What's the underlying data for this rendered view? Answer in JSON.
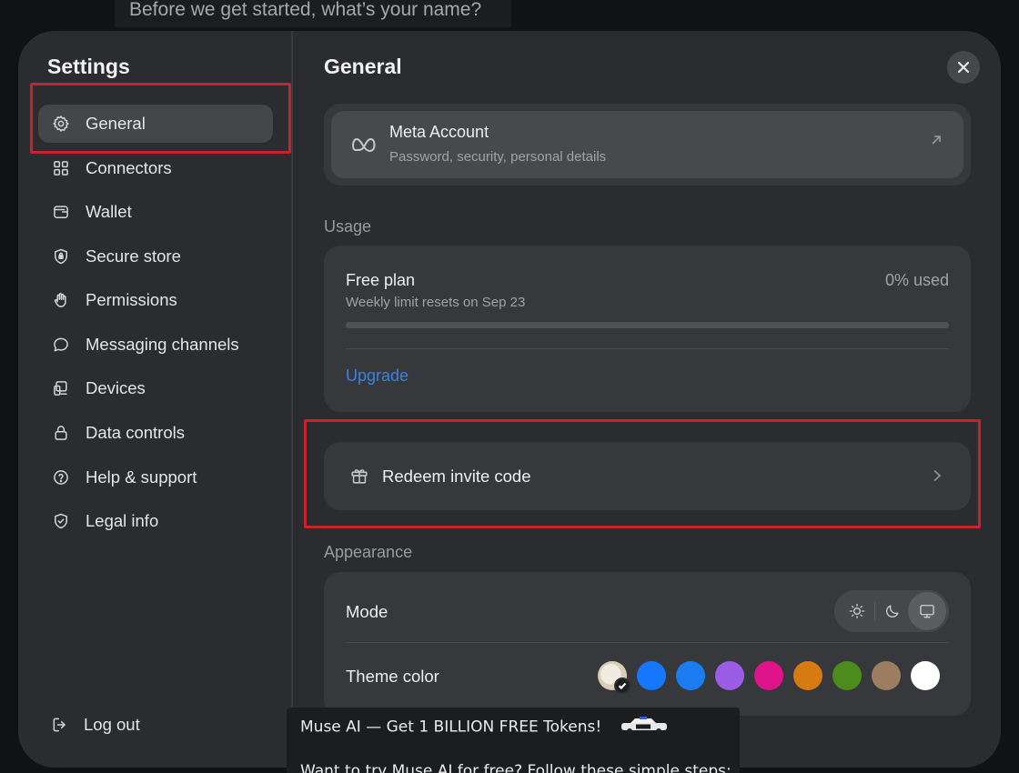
{
  "background_prompt": "Before we get started, what’s your name?",
  "sidebar": {
    "title": "Settings",
    "items": [
      {
        "label": "General",
        "icon": "gear-icon",
        "active": true
      },
      {
        "label": "Connectors",
        "icon": "grid-icon"
      },
      {
        "label": "Wallet",
        "icon": "wallet-icon"
      },
      {
        "label": "Secure store",
        "icon": "shield-lock-icon"
      },
      {
        "label": "Permissions",
        "icon": "hand-icon"
      },
      {
        "label": "Messaging channels",
        "icon": "chat-bubble-icon"
      },
      {
        "label": "Devices",
        "icon": "devices-icon"
      },
      {
        "label": "Data controls",
        "icon": "lock-icon"
      },
      {
        "label": "Help & support",
        "icon": "question-circle-icon"
      },
      {
        "label": "Legal info",
        "icon": "shield-check-icon"
      }
    ],
    "logout_label": "Log out"
  },
  "main": {
    "title": "General",
    "meta_account": {
      "title": "Meta Account",
      "subtitle": "Password, security, personal details",
      "icon": "meta-infinity-icon"
    },
    "usage": {
      "section_label": "Usage",
      "plan": "Free plan",
      "reset_text": "Weekly limit resets on Sep 23",
      "used_text": "0% used",
      "used_fraction": 0,
      "upgrade_label": "Upgrade"
    },
    "redeem": {
      "label": "Redeem invite code",
      "icon": "gift-icon"
    },
    "appearance": {
      "section_label": "Appearance",
      "mode_label": "Mode",
      "mode_options": [
        "light",
        "dark",
        "system"
      ],
      "selected_mode": "system",
      "theme_label": "Theme color",
      "theme_colors": [
        "#1677ff",
        "#1a7cf0",
        "#9b5de5",
        "#e0148a",
        "#d67a12",
        "#4b8c1c",
        "#9c7e63",
        "#ffffff"
      ]
    }
  },
  "overlay_post": {
    "line1": "Muse AI — Get 1 BILLION FREE Tokens!",
    "line2": "Want to try Muse AI for free? Follow these simple steps:"
  },
  "colors": {
    "accent": "#3b82e0",
    "highlight_box": "#c9232a"
  }
}
